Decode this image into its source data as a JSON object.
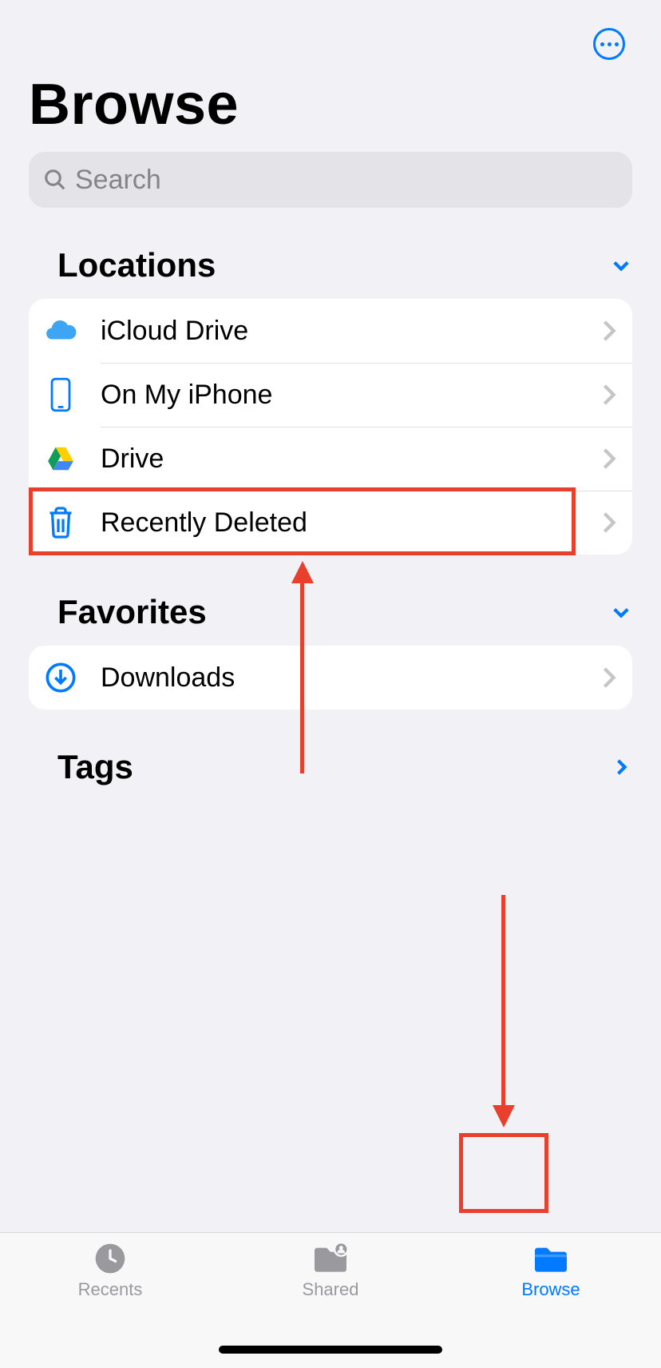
{
  "colors": {
    "accent": "#007aff",
    "annotation": "#e8402c"
  },
  "header": {
    "title": "Browse"
  },
  "search": {
    "placeholder": "Search"
  },
  "sections": {
    "locations": {
      "title": "Locations",
      "items": [
        {
          "label": "iCloud Drive",
          "icon": "icloud-icon"
        },
        {
          "label": "On My iPhone",
          "icon": "iphone-icon"
        },
        {
          "label": "Drive",
          "icon": "google-drive-icon"
        },
        {
          "label": "Recently Deleted",
          "icon": "trash-icon"
        }
      ]
    },
    "favorites": {
      "title": "Favorites",
      "items": [
        {
          "label": "Downloads",
          "icon": "download-circle-icon"
        }
      ]
    },
    "tags": {
      "title": "Tags"
    }
  },
  "tabbar": {
    "items": [
      {
        "label": "Recents",
        "icon": "clock-icon",
        "active": false
      },
      {
        "label": "Shared",
        "icon": "shared-folder-icon",
        "active": false
      },
      {
        "label": "Browse",
        "icon": "folder-icon",
        "active": true
      }
    ]
  }
}
